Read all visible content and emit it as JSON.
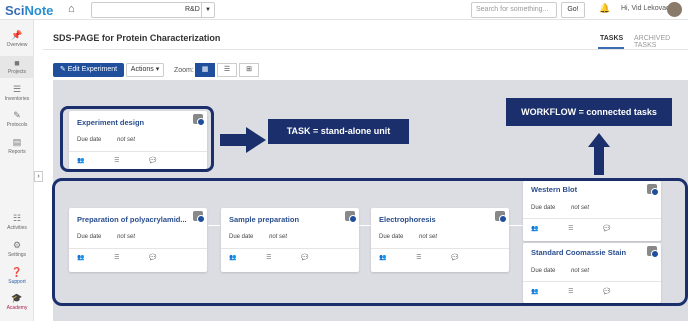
{
  "topbar": {
    "logo_a": "Sci",
    "logo_b": "Note",
    "project": "R&D",
    "search_placeholder": "Search for something...",
    "go": "Go!",
    "user": "Hi, Vid Lekovac"
  },
  "sidebar": {
    "items": [
      {
        "label": "Overview",
        "icon": "pin-icon"
      },
      {
        "label": "Projects",
        "icon": "folder-icon"
      },
      {
        "label": "Inventories",
        "icon": "list-icon"
      },
      {
        "label": "Protocols",
        "icon": "edit-icon"
      },
      {
        "label": "Reports",
        "icon": "clipboard-icon"
      },
      {
        "label": "Activities",
        "icon": "activities-icon"
      },
      {
        "label": "Settings",
        "icon": "gear-icon"
      },
      {
        "label": "Support",
        "icon": "help-icon"
      },
      {
        "label": "Academy",
        "icon": "mortarboard-icon"
      }
    ]
  },
  "page": {
    "title": "SDS-PAGE for Protein Characterization",
    "tabs": [
      "TASKS",
      "ARCHIVED TASKS"
    ]
  },
  "toolbar": {
    "edit": "Edit Experiment",
    "actions": "Actions",
    "zoom": "Zoom:"
  },
  "cards": [
    {
      "name": "Experiment design",
      "due_label": "Due date",
      "due": "not set"
    },
    {
      "name": "Preparation of polyacrylamid...",
      "due_label": "Due date",
      "due": "not set"
    },
    {
      "name": "Sample preparation",
      "due_label": "Due date",
      "due": "not set"
    },
    {
      "name": "Electrophoresis",
      "due_label": "Due date",
      "due": "not set"
    },
    {
      "name": "Western Blot",
      "due_label": "Due date",
      "due": "not set"
    },
    {
      "name": "Standard Coomassie Stain",
      "due_label": "Due date",
      "due": "not set"
    }
  ],
  "annotations": {
    "task": "TASK = stand-alone unit",
    "workflow": "WORKFLOW = connected tasks"
  },
  "colors": {
    "brand": "#1e4e9c",
    "annotation": "#1a2f6b",
    "canvas": "#dcdde3"
  }
}
